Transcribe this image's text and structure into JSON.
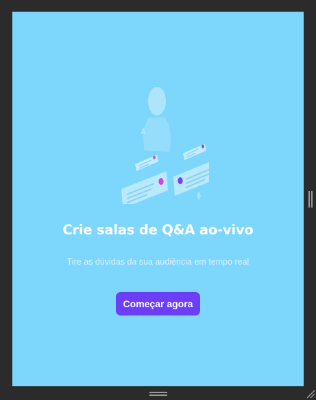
{
  "panel": {
    "title": "Crie salas de Q&A ao-vivo",
    "subtitle": "Tire as dúvidas da sua audiência em tempo real",
    "cta_label": "Começar agora"
  },
  "colors": {
    "window_bg": "#2b2b2b",
    "panel_bg": "#7dd6fb",
    "cta_bg": "#6c3ef7",
    "title_text": "#ffffff",
    "subtitle_text": "#dff2fd",
    "handle": "#9a9a9a"
  },
  "icons": {
    "illustration": "qa-chat-illustration",
    "right_handle": "vertical-resize-handle",
    "bottom_handle": "horizontal-resize-handle",
    "corner": "corner-resize-grip"
  }
}
